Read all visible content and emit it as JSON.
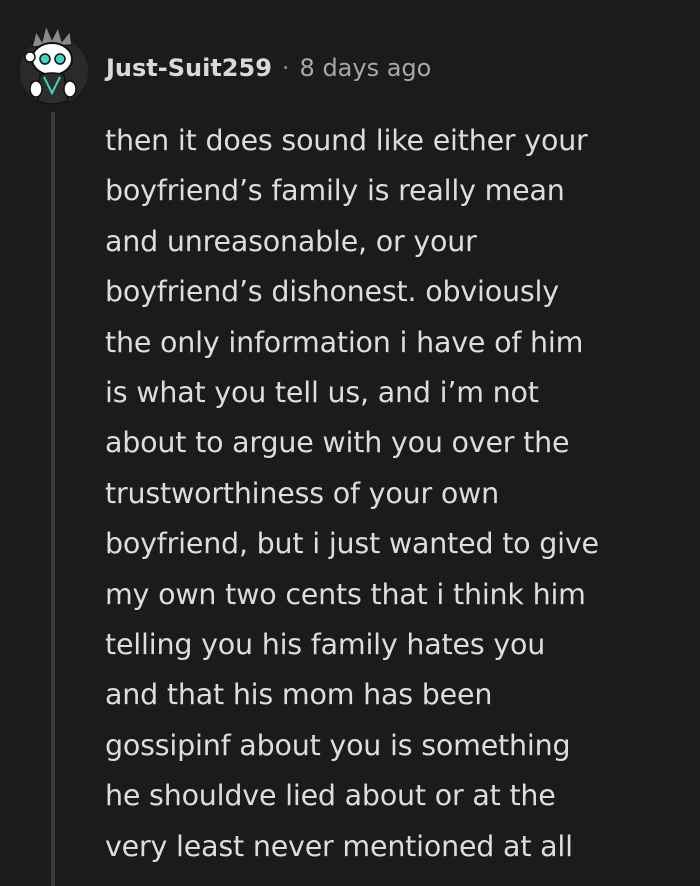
{
  "comment": {
    "username": "Just-Suit259",
    "separator": "·",
    "timestamp": "8 days ago",
    "avatar_icon": "snoo-avatar-icon",
    "body_lines": [
      "then it does sound like either your",
      "boyfriend’s family is really mean",
      "and unreasonable, or your",
      "boyfriend’s dishonest. obviously",
      "the only information i have of him",
      "is what you tell us, and i’m not",
      "about to argue with you over the",
      "trustworthiness of your own",
      "boyfriend, but i just wanted to give",
      "my own two cents that i think him",
      "telling you his family hates you",
      "and that his mom has been",
      "gossipinf about you is something",
      "he shouldve lied about or at the",
      "very least never mentioned at all"
    ]
  },
  "colors": {
    "background": "#1b1b1c",
    "text": "#dddddd",
    "muted": "#a8a8aa",
    "thread_line": "#3a3a3c",
    "avatar_accent": "#3fd2c7"
  }
}
